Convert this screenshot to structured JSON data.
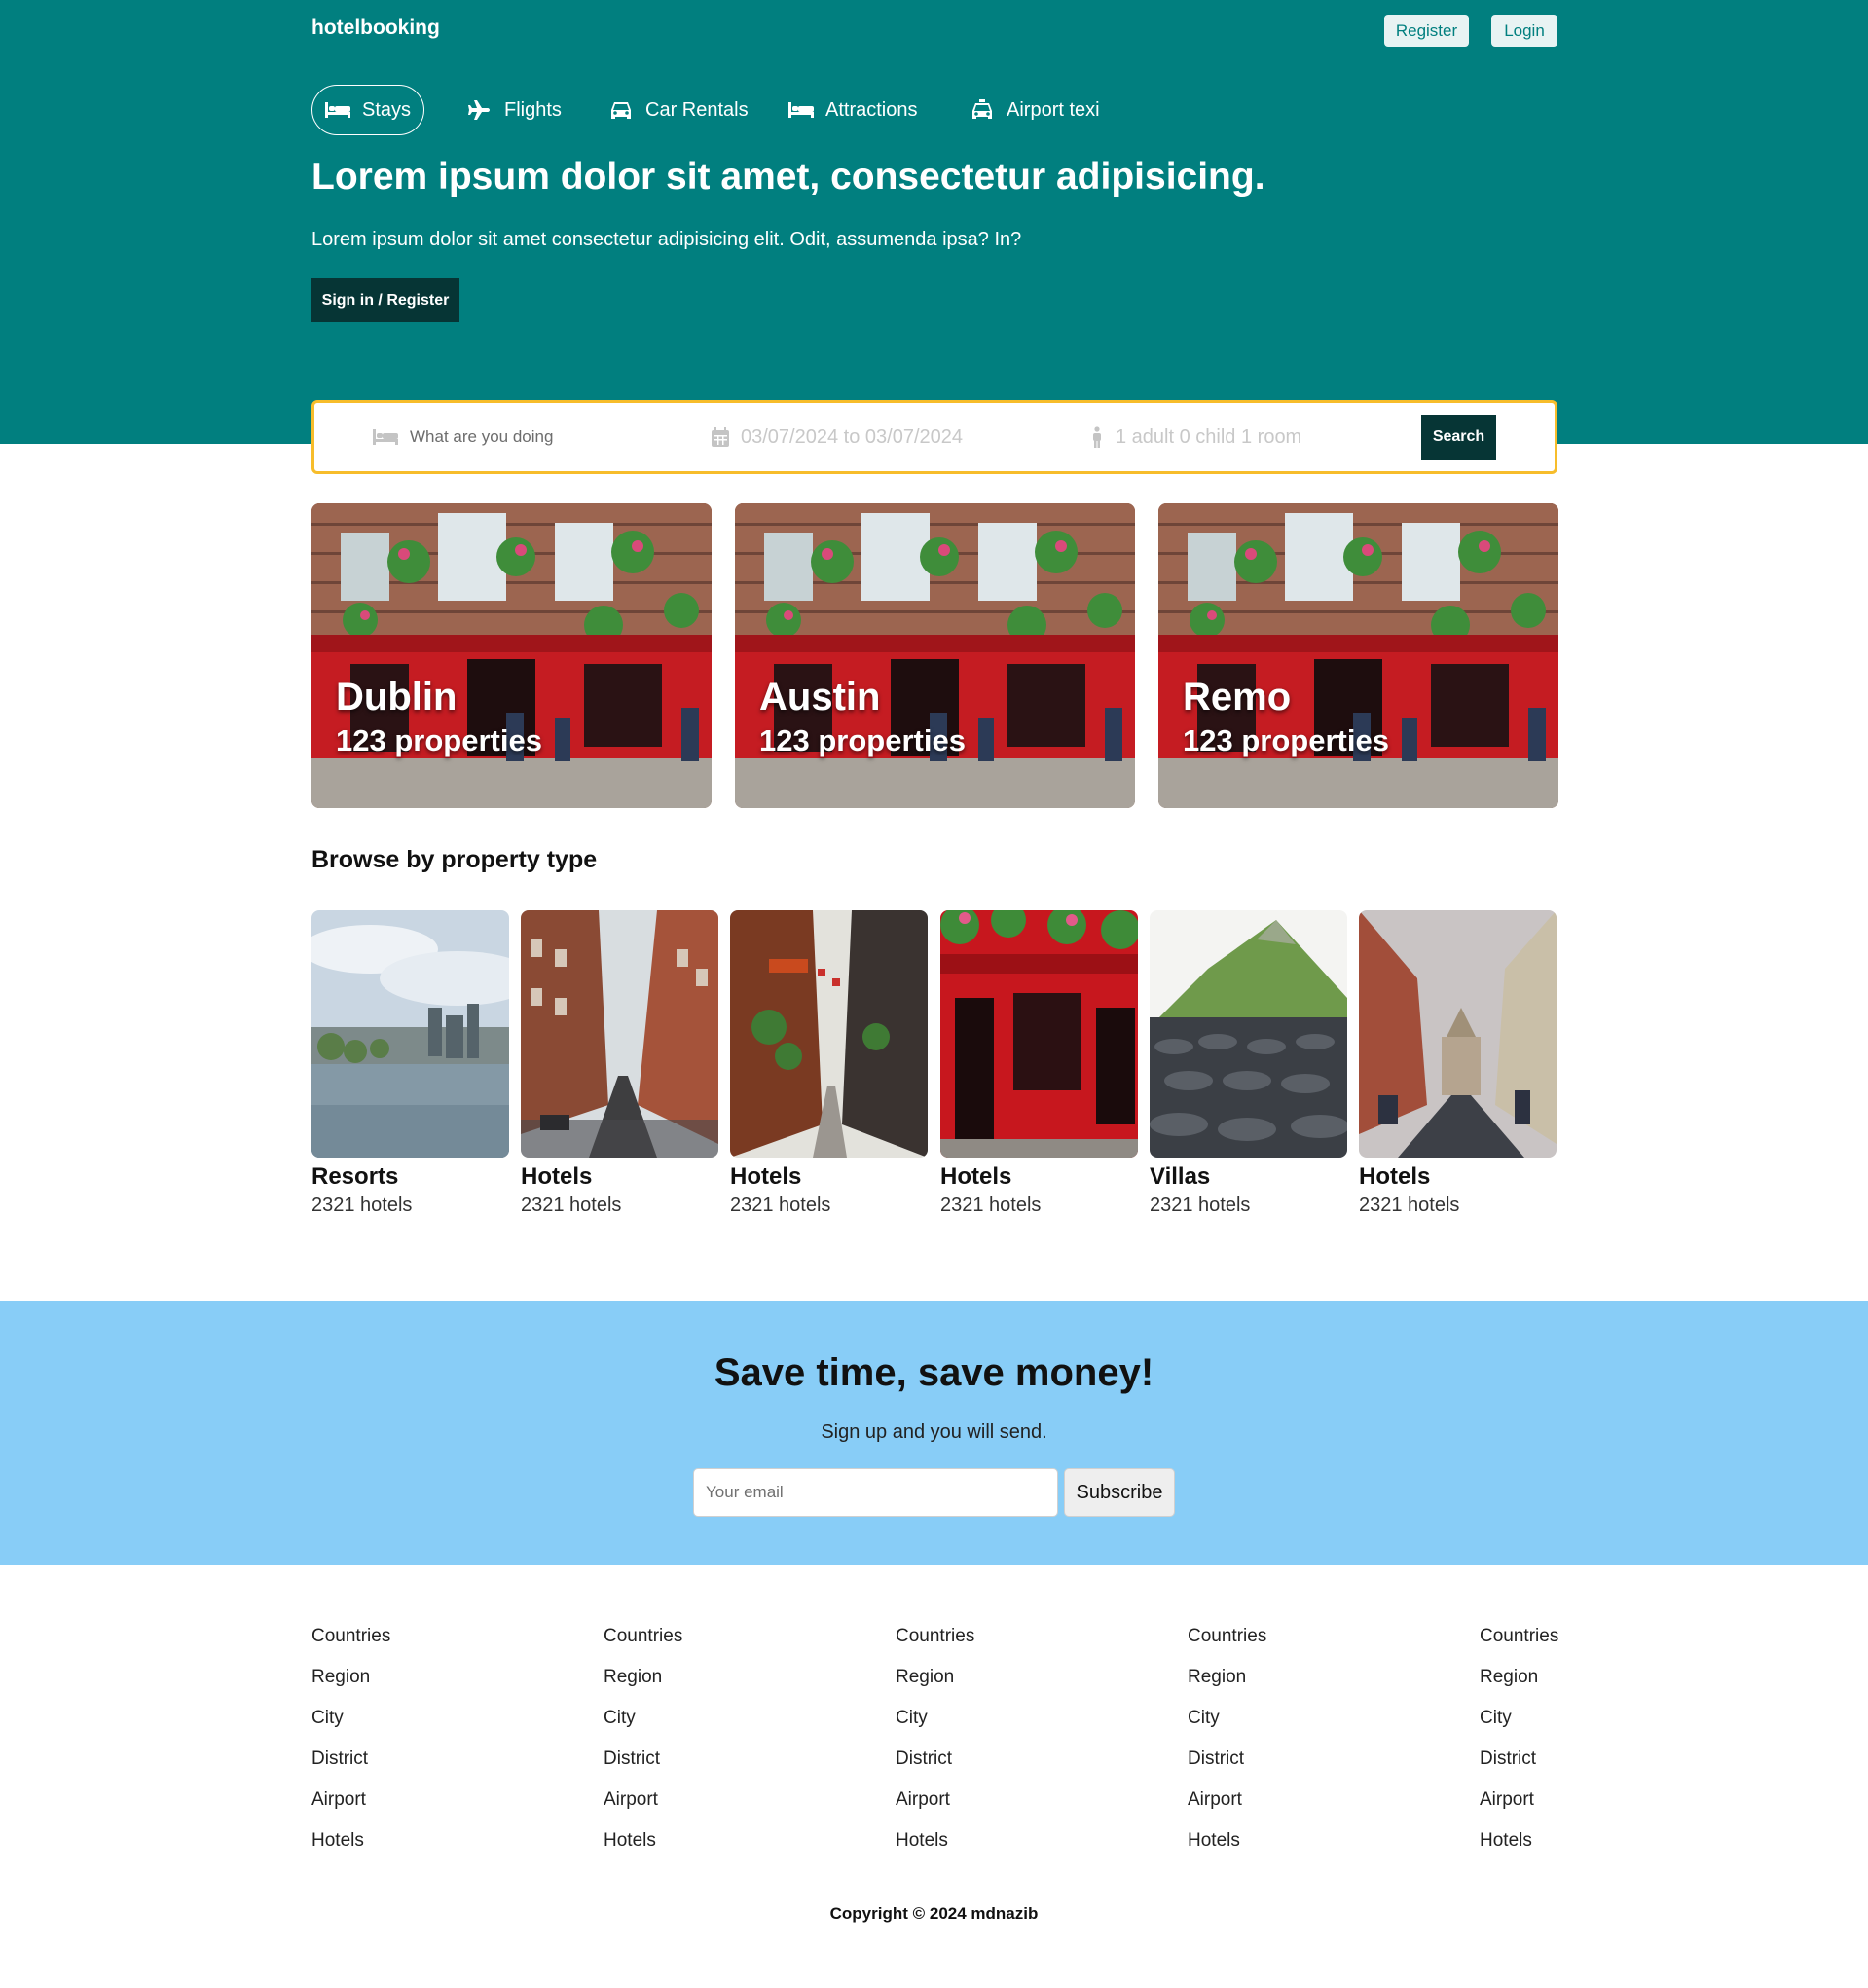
{
  "header": {
    "logo": "hotelbooking",
    "register_label": "Register",
    "login_label": "Login",
    "nav": [
      {
        "label": "Stays",
        "icon": "bed-icon",
        "active": true
      },
      {
        "label": "Flights",
        "icon": "plane-icon"
      },
      {
        "label": "Car Rentals",
        "icon": "car-icon"
      },
      {
        "label": "Attractions",
        "icon": "bed-icon"
      },
      {
        "label": "Airport texi",
        "icon": "taxi-icon"
      }
    ],
    "title": "Lorem ipsum dolor sit amet, consectetur adipisicing.",
    "subtitle": "Lorem ipsum dolor sit amet consectetur adipisicing elit. Odit, assumenda ipsa? In?",
    "signin_label": "Sign in / Register"
  },
  "search": {
    "destination_placeholder": "What are you doing",
    "date_range": "03/07/2024 to 03/07/2024",
    "guests": "1 adult 0 child 1 room",
    "button_label": "Search"
  },
  "featured": [
    {
      "city": "Dublin",
      "properties": "123 properties"
    },
    {
      "city": "Austin",
      "properties": "123 properties"
    },
    {
      "city": "Remo",
      "properties": "123 properties"
    }
  ],
  "browse": {
    "title": "Browse by property type",
    "items": [
      {
        "name": "Resorts",
        "count": "2321 hotels",
        "image": "river-city"
      },
      {
        "name": "Hotels",
        "count": "2321 hotels",
        "image": "brick-street"
      },
      {
        "name": "Hotels",
        "count": "2321 hotels",
        "image": "narrow-alley"
      },
      {
        "name": "Hotels",
        "count": "2321 hotels",
        "image": "red-pub"
      },
      {
        "name": "Villas",
        "count": "2321 hotels",
        "image": "basalt-coast"
      },
      {
        "name": "Hotels",
        "count": "2321 hotels",
        "image": "church-street"
      }
    ]
  },
  "newsletter": {
    "title": "Save time, save money!",
    "subtitle": "Sign up and you will send.",
    "email_placeholder": "Your email",
    "button_label": "Subscribe"
  },
  "footer": {
    "columns": [
      [
        "Countries",
        "Region",
        "City",
        "District",
        "Airport",
        "Hotels"
      ],
      [
        "Countries",
        "Region",
        "City",
        "District",
        "Airport",
        "Hotels"
      ],
      [
        "Countries",
        "Region",
        "City",
        "District",
        "Airport",
        "Hotels"
      ],
      [
        "Countries",
        "Region",
        "City",
        "District",
        "Airport",
        "Hotels"
      ],
      [
        "Countries",
        "Region",
        "City",
        "District",
        "Airport",
        "Hotels"
      ]
    ],
    "copyright": "Copyright © 2024 mdnazib"
  },
  "colors": {
    "header_bg": "#017f7f",
    "dark_button": "#063535",
    "search_border": "#f7bd2b",
    "newsletter_bg": "#88cdf7"
  }
}
